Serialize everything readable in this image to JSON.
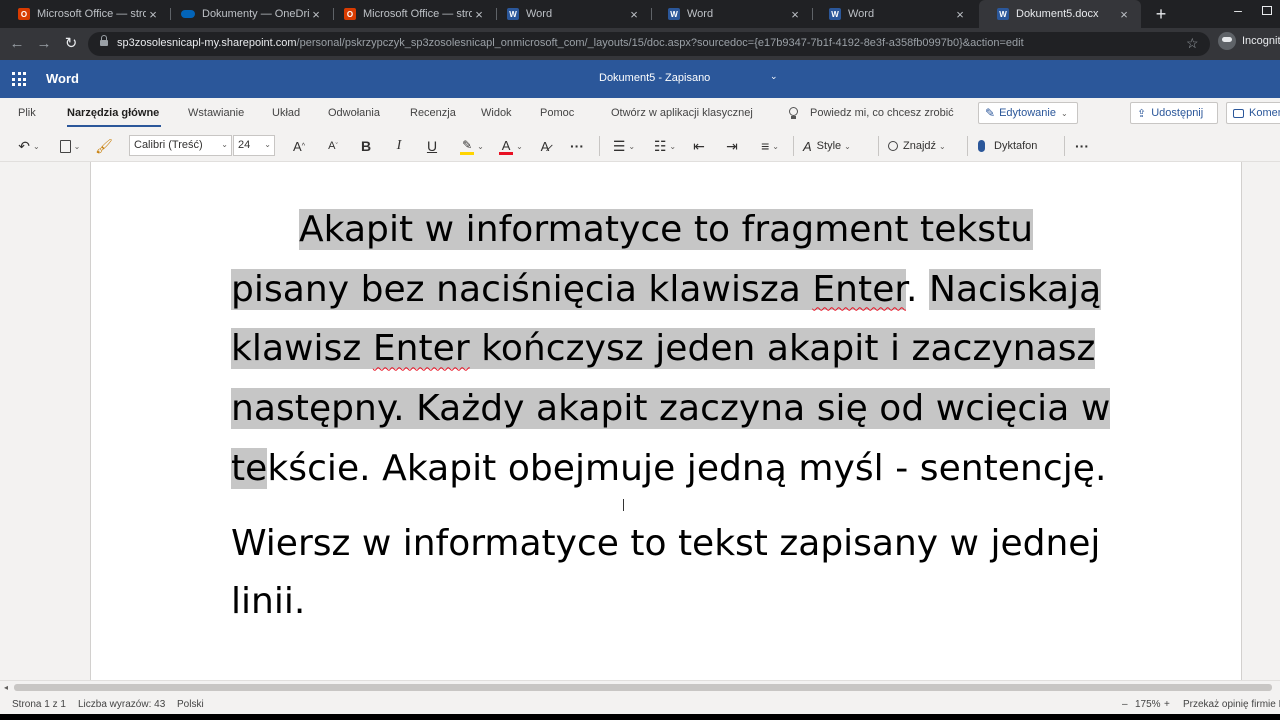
{
  "browser": {
    "tabs": [
      {
        "title": "Microsoft Office — stron",
        "icon": "office-icon",
        "color": "#d83b01",
        "active": false
      },
      {
        "title": "Dokumenty — OneDrive",
        "icon": "onedrive-icon",
        "color": "#0364b8",
        "active": false
      },
      {
        "title": "Microsoft Office — stron",
        "icon": "office-icon",
        "color": "#d83b01",
        "active": false
      },
      {
        "title": "Word",
        "icon": "word-icon",
        "color": "#2b579a",
        "active": false
      },
      {
        "title": "Word",
        "icon": "word-icon",
        "color": "#2b579a",
        "active": false
      },
      {
        "title": "Word",
        "icon": "word-icon",
        "color": "#2b579a",
        "active": false
      },
      {
        "title": "Dokument5.docx",
        "icon": "word-icon",
        "color": "#2b579a",
        "active": true
      }
    ],
    "url_host": "sp3zosolesnicapl-my.sharepoint.com",
    "url_path": "/personal/pskrzypczyk_sp3zosolesnicapl_onmicrosoft_com/_layouts/15/doc.aspx?sourcedoc={e17b9347-7b1f-4192-8e3f-a358fb0997b0}&action=edit",
    "profile_label": "Incognito"
  },
  "app": {
    "name": "Word",
    "document_title": "Dokument5",
    "save_status": "Zapisano",
    "accent_color": "#2b579a"
  },
  "ribbon": {
    "tabs": [
      "Plik",
      "Narzędzia główne",
      "Wstawianie",
      "Układ",
      "Odwołania",
      "Recenzja",
      "Widok",
      "Pomoc",
      "Otwórz w aplikacji klasycznej",
      "Powiedz mi, co chcesz zrobić"
    ],
    "active_tab": "Narzędzia główne",
    "editing_mode": "Edytowanie",
    "share_label": "Udostępnij",
    "comments_label": "Komentarze"
  },
  "toolbar": {
    "font_name": "Calibri (Treść)",
    "font_size": "24",
    "styles_label": "Style",
    "find_label": "Znajdź",
    "dictate_label": "Dyktafon",
    "bold_glyph": "B",
    "italic_glyph": "I",
    "underline_glyph": "U"
  },
  "document": {
    "p1_sel1": "Akapit w informatyce to fragment tekstu pisany bez naciśnięcia klawisza ",
    "p1_sel1_err": "Enter",
    "p1_gap": ".",
    "p1_sel2": "Naciskają klawisz ",
    "p1_sel2_err": "Enter",
    "p1_sel3": " kończysz jeden akapit i zaczynasz następny. Każdy akapit zaczyna się od wcięcia w te",
    "p1_rest": "kście. Akapit obejmuje jedną myśl - sentencję.",
    "p2": "Wiersz w informatyce to tekst zapisany w jednej linii."
  },
  "status": {
    "page": "Strona 1 z 1",
    "word_count": "Liczba wyrazów: 43",
    "language": "Polski",
    "zoom": "175%",
    "feedback": "Przekaż opinię firmie Microsoft"
  }
}
